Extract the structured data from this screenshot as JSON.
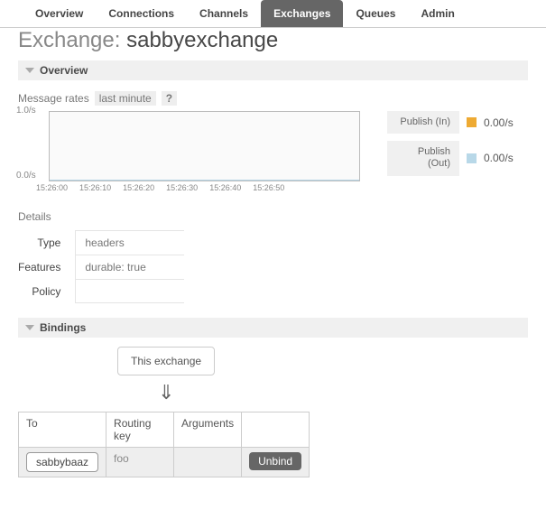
{
  "tabs": {
    "items": [
      "Overview",
      "Connections",
      "Channels",
      "Exchanges",
      "Queues",
      "Admin"
    ],
    "active": 3
  },
  "title_prefix": "Exchange: ",
  "title_name": "sabbyexchange",
  "section_overview": "Overview",
  "rates_label": "Message rates",
  "rates_range": "last minute",
  "rates_help": "?",
  "chart_data": {
    "type": "line",
    "ylabel_top": "1.0/s",
    "ylabel_bottom": "0.0/s",
    "xticks": [
      "15:26:00",
      "15:26:10",
      "15:26:20",
      "15:26:30",
      "15:26:40",
      "15:26:50"
    ],
    "ylim": [
      0,
      1
    ],
    "series": [
      {
        "name": "Publish (In)",
        "color": "#eeaa33",
        "value_text": "0.00/s",
        "values": [
          0,
          0,
          0,
          0,
          0,
          0
        ]
      },
      {
        "name": "Publish (Out)",
        "color": "#b8d8e8",
        "value_text": "0.00/s",
        "values": [
          0,
          0,
          0,
          0,
          0,
          0
        ]
      }
    ]
  },
  "details_heading": "Details",
  "details": {
    "type_label": "Type",
    "type_value": "headers",
    "features_label": "Features",
    "features_value": "durable: true",
    "policy_label": "Policy",
    "policy_value": ""
  },
  "section_bindings": "Bindings",
  "this_exchange_label": "This exchange",
  "arrow_glyph": "⇓",
  "bindings_table": {
    "headers": [
      "To",
      "Routing key",
      "Arguments"
    ],
    "rows": [
      {
        "to": "sabbybaaz",
        "routing_key": "foo",
        "arguments": "",
        "unbind": "Unbind"
      }
    ]
  }
}
